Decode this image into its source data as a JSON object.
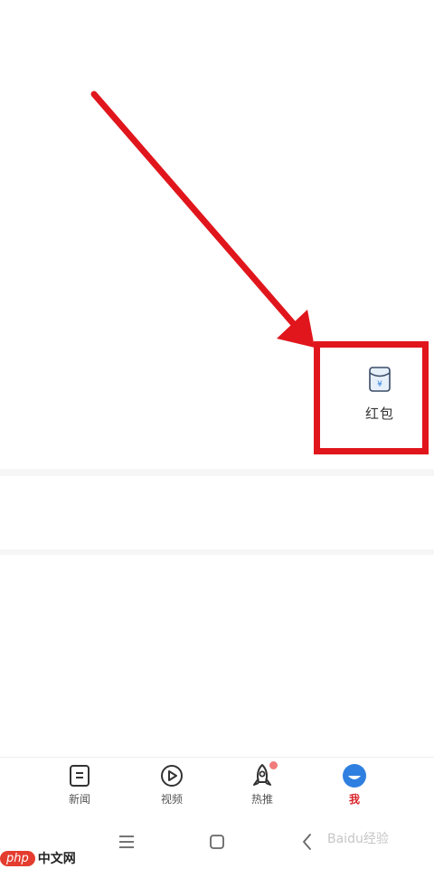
{
  "grid": {
    "red_packet_label": "红包"
  },
  "tabbar": {
    "tabs": [
      {
        "label": "新闻",
        "icon": "news-icon",
        "active": false
      },
      {
        "label": "视频",
        "icon": "video-play-icon",
        "active": false
      },
      {
        "label": "热推",
        "icon": "rocket-icon",
        "active": false,
        "badge_dot": true
      },
      {
        "label": "我",
        "icon": "me-avatar-icon",
        "active": true
      }
    ]
  },
  "system_nav": {
    "buttons": [
      "menu-icon",
      "home-square-icon",
      "back-chevron-icon"
    ]
  },
  "watermark": {
    "badge": "php",
    "site": "中文网",
    "right_text": "Baidu经验"
  },
  "colors": {
    "annotation_red": "#e0161c",
    "active_tab": "#d9232a",
    "avatar_blue": "#2f7fe0",
    "badge_dot": "#f07b7b"
  }
}
